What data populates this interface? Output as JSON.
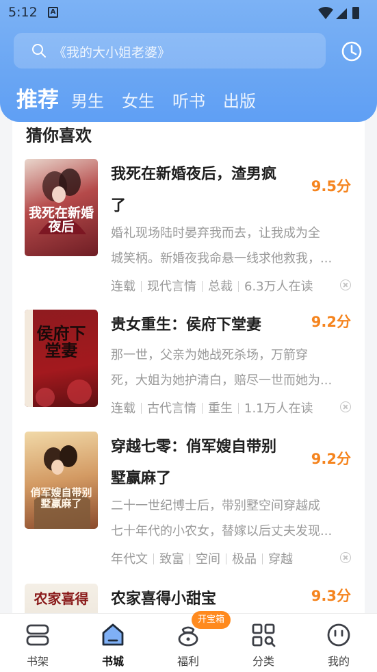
{
  "status_bar": {
    "time": "5:12",
    "notification_icon": "A"
  },
  "search": {
    "placeholder": "《我的大小姐老婆》"
  },
  "tabs": [
    {
      "label": "推荐",
      "active": true
    },
    {
      "label": "男生"
    },
    {
      "label": "女生"
    },
    {
      "label": "听书"
    },
    {
      "label": "出版"
    }
  ],
  "section_title": "猜你喜欢",
  "books": [
    {
      "title_line1": "我死在新婚夜后，渣男疯",
      "title_line2": "了",
      "score": "9.5分",
      "desc_line1": "婚礼现场陆时晏弃我而去，让我成为全",
      "desc_line2": "城笑柄。新婚夜我命悬一线求他救我，...",
      "tags": [
        "连载",
        "现代言情",
        "总裁",
        "6.3万人在读"
      ],
      "cover_text": "我死在新婚夜后"
    },
    {
      "title_line1": "贵女重生：侯府下堂妻",
      "title_line2": "",
      "score": "9.2分",
      "desc_line1": "那一世，父亲为她战死杀场，万箭穿",
      "desc_line2": "死，大姐为她护清白，赔尽一世而她为...",
      "tags": [
        "连载",
        "古代言情",
        "重生",
        "1.1万人在读"
      ],
      "cover_text": "侯府下堂妻"
    },
    {
      "title_line1": "穿越七零：俏军嫂自带别",
      "title_line2": "墅赢麻了",
      "score": "9.2分",
      "desc_line1": "二十一世纪博士后，带别墅空间穿越成",
      "desc_line2": "七十年代的小农女，替嫁以后丈夫发现...",
      "tags": [
        "年代文",
        "致富",
        "空间",
        "极品",
        "穿越"
      ],
      "cover_text": "俏军嫂自带别墅赢麻了"
    },
    {
      "title_line1": "农家喜得小甜宝",
      "title_line2": "",
      "score": "9.3分",
      "cover_text": "农家喜得"
    }
  ],
  "bottom_nav": {
    "items": [
      {
        "label": "书架",
        "icon": "bookshelf-icon"
      },
      {
        "label": "书城",
        "icon": "bookstore-icon",
        "active": true
      },
      {
        "label": "福利",
        "icon": "welfare-icon"
      },
      {
        "label": "分类",
        "icon": "category-icon"
      },
      {
        "label": "我的",
        "icon": "profile-icon"
      }
    ],
    "badge": "开宝箱"
  },
  "colors": {
    "accent": "#6aa6f3",
    "score": "#f5841e",
    "nav_active": "#1e2a3a"
  }
}
